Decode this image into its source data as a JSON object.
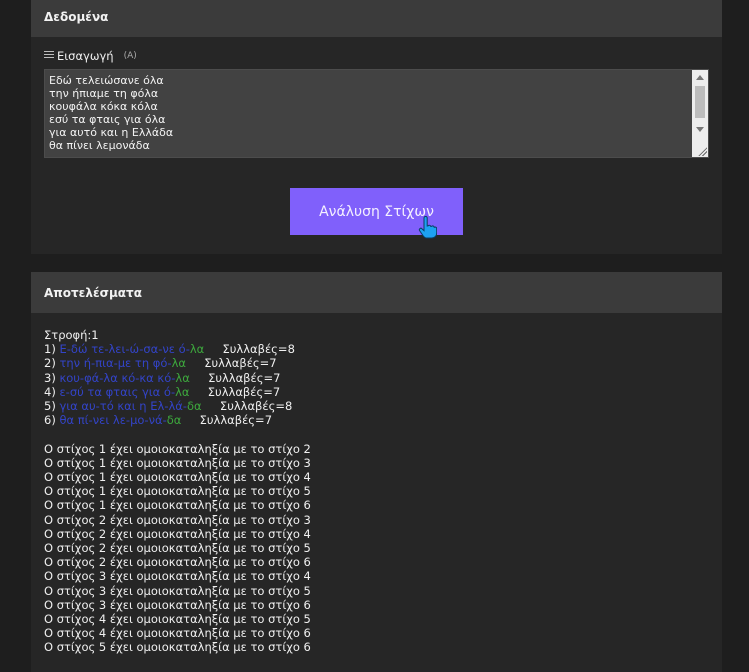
{
  "data_panel": {
    "title": "Δεδομένα",
    "input_label": "Εισαγωγή",
    "lang_hint": "(A)",
    "textarea_lines": [
      "Εδώ τελειώσανε όλα",
      "την ήπιαμε τη φόλα",
      "κουφάλα κόκα κόλα",
      "εσύ τα φταις για όλα",
      "για αυτό και η Ελλάδα",
      "θα πίνει λεμονάδα"
    ],
    "button_label": "Ανάλυση Στίχων"
  },
  "results_panel": {
    "title": "Αποτελέσματα",
    "stanza_label": "Στροφή:1",
    "verses": [
      {
        "num": "1)",
        "blue": "Ε-δώ τε-λει-ώ-σα-νε ό-",
        "green": "λα",
        "syllables": "Συλλαβές=8"
      },
      {
        "num": "2)",
        "blue": "την ή-πια-με τη φό-",
        "green": "λα",
        "syllables": "Συλλαβές=7"
      },
      {
        "num": "3)",
        "blue": "κου-φά-λα κό-κα κό-",
        "green": "λα",
        "syllables": "Συλλαβές=7"
      },
      {
        "num": "4)",
        "blue": "ε-σύ τα φταις για ό-",
        "green": "λα",
        "syllables": "Συλλαβές=7"
      },
      {
        "num": "5)",
        "blue": "για αυ-τό και η Ελ-λά-",
        "green": "δα",
        "syllables": "Συλλαβές=8"
      },
      {
        "num": "6)",
        "blue": "θα πί-νει λε-μο-νά-",
        "green": "δα",
        "syllables": "Συλλαβές=7"
      }
    ],
    "rhymes": [
      "Ο στίχος 1 έχει ομοιοκαταληξία με το στίχο 2",
      "Ο στίχος 1 έχει ομοιοκαταληξία με το στίχο 3",
      "Ο στίχος 1 έχει ομοιοκαταληξία με το στίχο 4",
      "Ο στίχος 1 έχει ομοιοκαταληξία με το στίχο 5",
      "Ο στίχος 1 έχει ομοιοκαταληξία με το στίχο 6",
      "Ο στίχος 2 έχει ομοιοκαταληξία με το στίχο 3",
      "Ο στίχος 2 έχει ομοιοκαταληξία με το στίχο 4",
      "Ο στίχος 2 έχει ομοιοκαταληξία με το στίχο 5",
      "Ο στίχος 2 έχει ομοιοκαταληξία με το στίχο 6",
      "Ο στίχος 3 έχει ομοιοκαταληξία με το στίχο 4",
      "Ο στίχος 3 έχει ομοιοκαταληξία με το στίχο 5",
      "Ο στίχος 3 έχει ομοιοκαταληξία με το στίχο 6",
      "Ο στίχος 4 έχει ομοιοκαταληξία με το στίχο 5",
      "Ο στίχος 4 έχει ομοιοκαταληξία με το στίχο 6",
      "Ο στίχος 5 έχει ομοιοκαταληξία με το στίχο 6"
    ]
  },
  "colors": {
    "accent_button": "#8060fb",
    "syllable_text": "#3344c8",
    "rhyme_ending": "#3da83d"
  },
  "icons": {
    "input_label_icon": "list-icon",
    "cursor": "hand-pointer-icon"
  }
}
